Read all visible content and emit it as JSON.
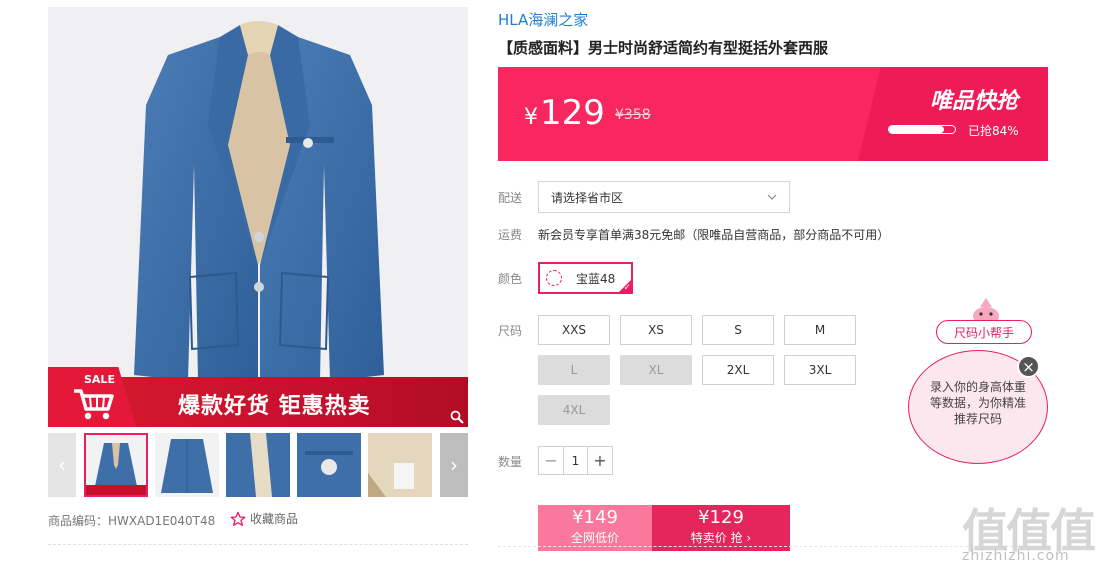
{
  "product": {
    "brand": "HLA海澜之家",
    "title": "【质感面料】男士时尚舒适简约有型挺括外套西服",
    "sku_line": "商品编码：HWXAD1E040T48",
    "favorite_label": "收藏商品"
  },
  "gallery": {
    "promo_sale": "SALE",
    "promo_text": "爆款好货 钜惠热卖",
    "prev_arrow": "‹",
    "next_arrow": "›"
  },
  "price": {
    "currency": "¥",
    "current": "129",
    "original": "¥358",
    "flash_title": "唯品快抢",
    "progress_fraction": 0.84,
    "progress_text": "已抢84%"
  },
  "delivery": {
    "label": "配送",
    "placeholder": "请选择省市区"
  },
  "shipping": {
    "label": "运费",
    "text": "新会员专享首单满38元免邮（限唯品自营商品，部分商品不可用）"
  },
  "color": {
    "label": "颜色",
    "selected": "宝蓝48"
  },
  "size": {
    "label": "尺码",
    "options": [
      {
        "label": "XXS",
        "available": true
      },
      {
        "label": "XS",
        "available": true
      },
      {
        "label": "S",
        "available": true
      },
      {
        "label": "M",
        "available": true
      },
      {
        "label": "L",
        "available": false
      },
      {
        "label": "XL",
        "available": false
      },
      {
        "label": "2XL",
        "available": true
      },
      {
        "label": "3XL",
        "available": true
      },
      {
        "label": "4XL",
        "available": false
      }
    ]
  },
  "quantity": {
    "label": "数量",
    "value": "1",
    "minus": "−",
    "plus": "+"
  },
  "buy": {
    "market_price": "¥149",
    "market_label": "全网低价",
    "special_price": "¥129",
    "special_label": "特卖价 抢 ›"
  },
  "size_helper": {
    "label": "尺码小帮手",
    "bubble_text": "录入你的身高体重等数据，为你精准推荐尺码",
    "close": "×"
  },
  "watermark": {
    "logo": "值值值",
    "url": "zhizhizhi.com"
  },
  "colors": {
    "accent": "#e91e63",
    "banner": "#f8275f",
    "brand_link": "#1e7fd8",
    "jacket": "#3f6fa8"
  }
}
